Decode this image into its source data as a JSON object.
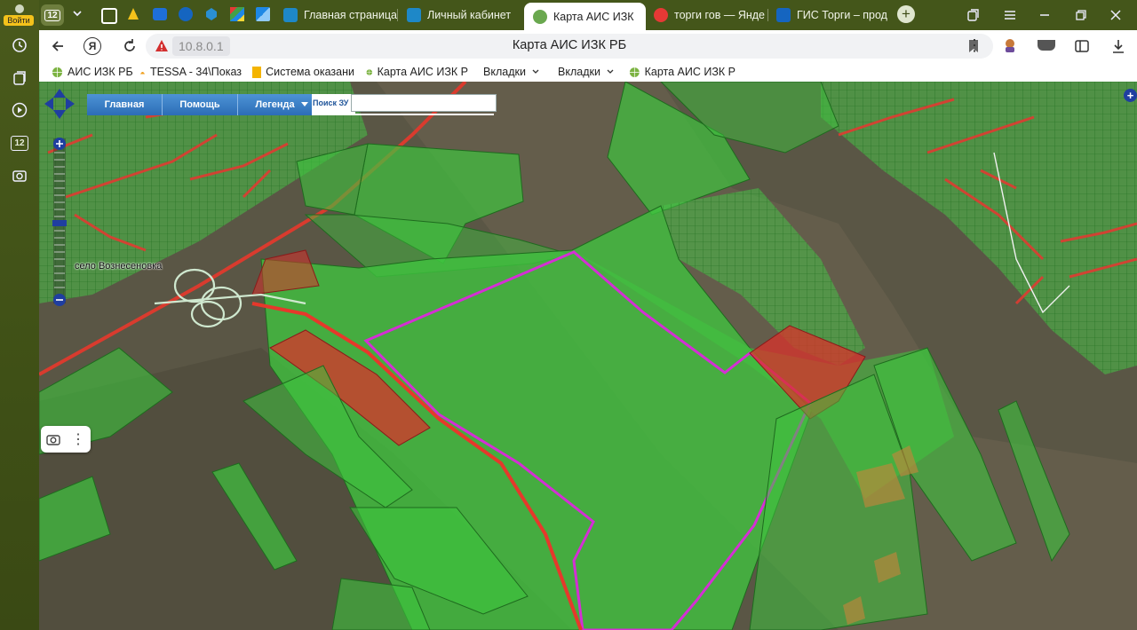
{
  "sidebar": {
    "login_label": "Войти",
    "items": [
      {
        "icon": "history-icon"
      },
      {
        "icon": "collections-icon"
      },
      {
        "icon": "play-icon"
      },
      {
        "icon": "tab-counter-icon",
        "value": "12"
      },
      {
        "icon": "screenshot-icon"
      }
    ]
  },
  "tabbar": {
    "tab_count": "12",
    "tabs": [
      {
        "label": "Главная страница",
        "icon_color": "#1e88c8"
      },
      {
        "label": "Личный кабинет",
        "icon_color": "#1e88c8"
      },
      {
        "label": "Карта АИС ИЗК",
        "icon_color": "#6aa84f",
        "active": true
      },
      {
        "label": "торги гов — Янде",
        "icon_color": "#e53935"
      },
      {
        "label": "ГИС Торги – прод",
        "icon_color": "#1565c0"
      }
    ]
  },
  "address": {
    "url": "10.8.0.1",
    "page_title": "Карта АИС ИЗК РБ"
  },
  "bookmarks": [
    {
      "label": "АИС ИЗК РБ",
      "icon": "globe-icon"
    },
    {
      "label": "TESSA - 34\\Показ",
      "icon": "tessa-icon"
    },
    {
      "label": "Система оказани",
      "icon": "folder-icon"
    },
    {
      "label": "Карта АИС ИЗК Р",
      "icon": "globe-icon"
    },
    {
      "label": "Вкладки",
      "icon": "chevron-down-icon"
    },
    {
      "label": "Вкладки",
      "icon": "chevron-down-icon"
    },
    {
      "label": "Карта АИС ИЗК Р",
      "icon": "globe-icon"
    }
  ],
  "map": {
    "menu": [
      {
        "label": "Главная"
      },
      {
        "label": "Помощь"
      },
      {
        "label": "Легенда"
      }
    ],
    "search_label": "Поиск ЗУ",
    "search_value": "",
    "place_label": "село Вознесеновка",
    "colors": {
      "parcel_green": "#3ec43e",
      "parcel_red": "#d9312b",
      "selected_outline": "#d42fd4",
      "terrain": "#54503f"
    }
  }
}
